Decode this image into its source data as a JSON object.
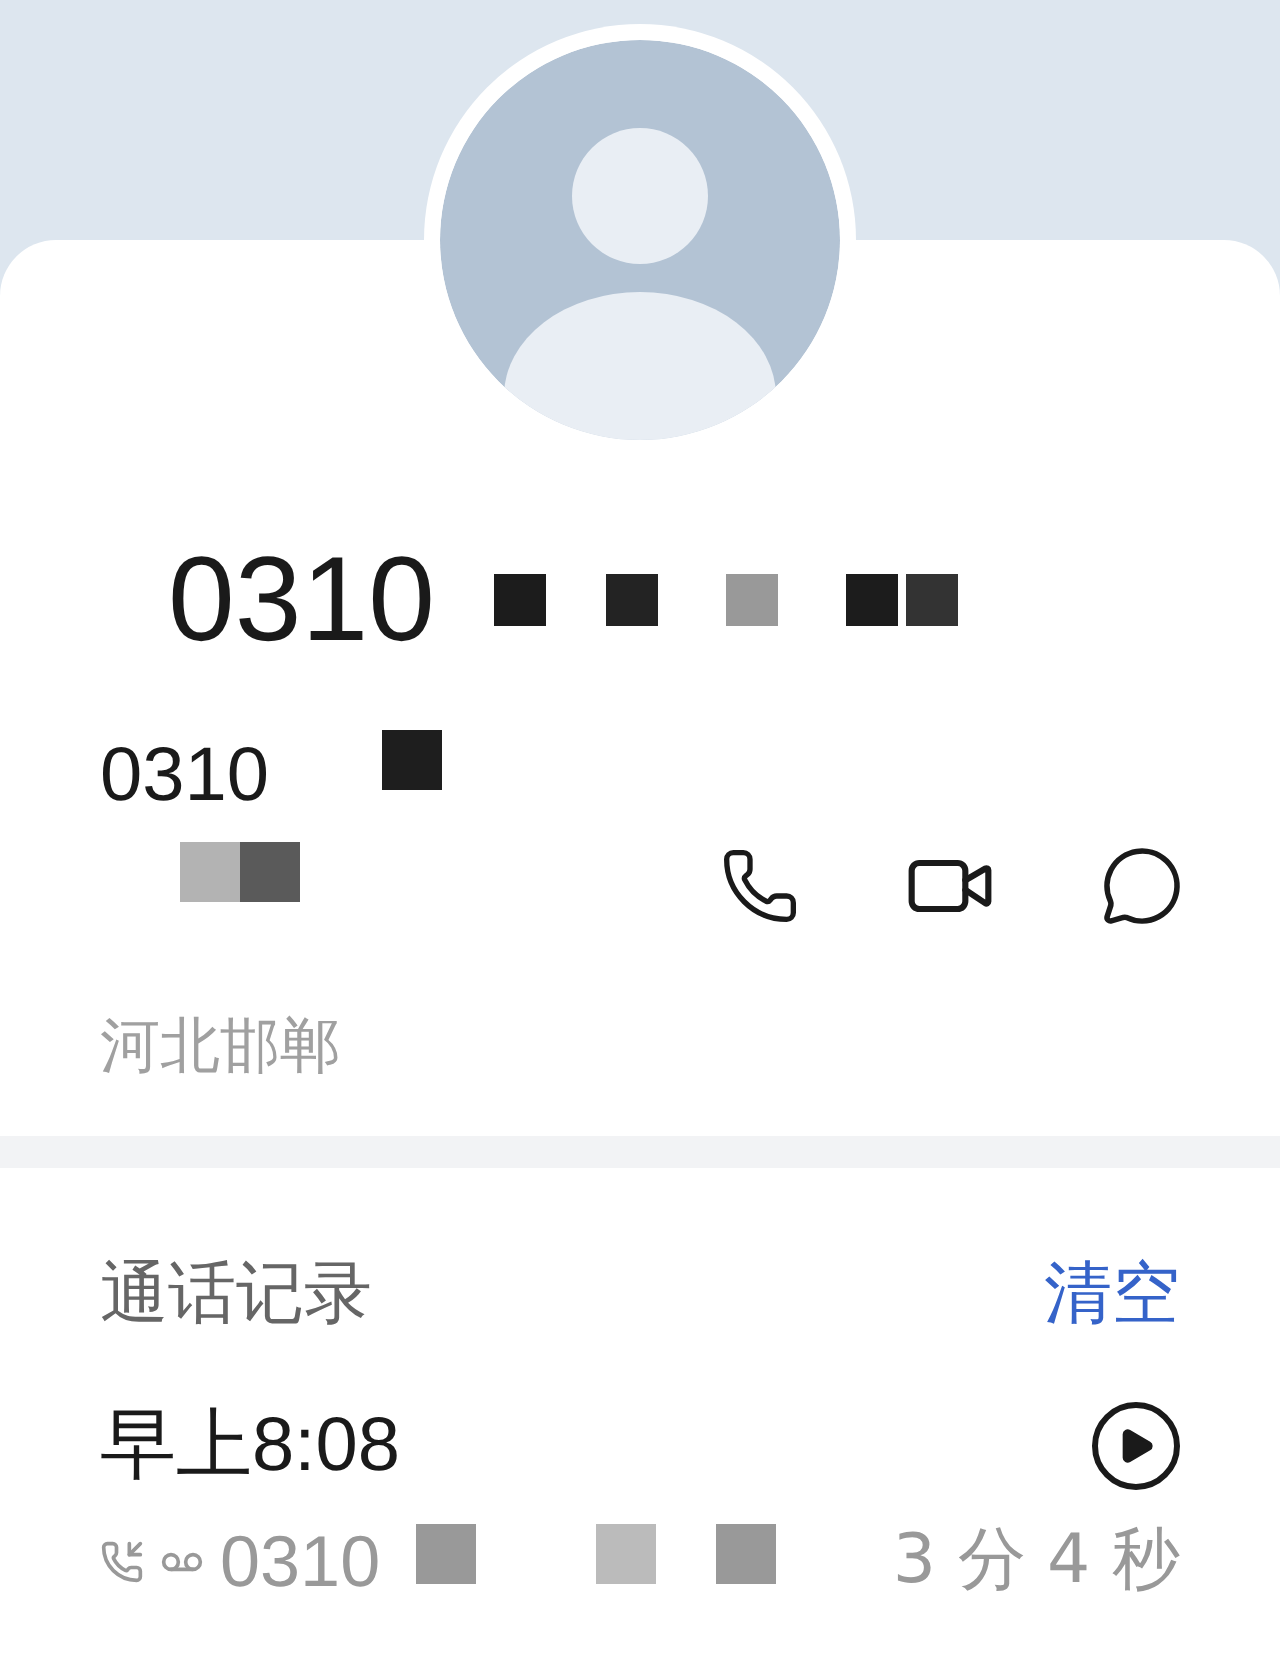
{
  "contact": {
    "title_number": "0310",
    "number": "0310",
    "location": "河北邯郸"
  },
  "call_log": {
    "title": "通话记录",
    "clear_label": "清空",
    "entries": [
      {
        "time": "早上8:08",
        "number": "0310",
        "duration": "3 分 4 秒"
      }
    ]
  }
}
